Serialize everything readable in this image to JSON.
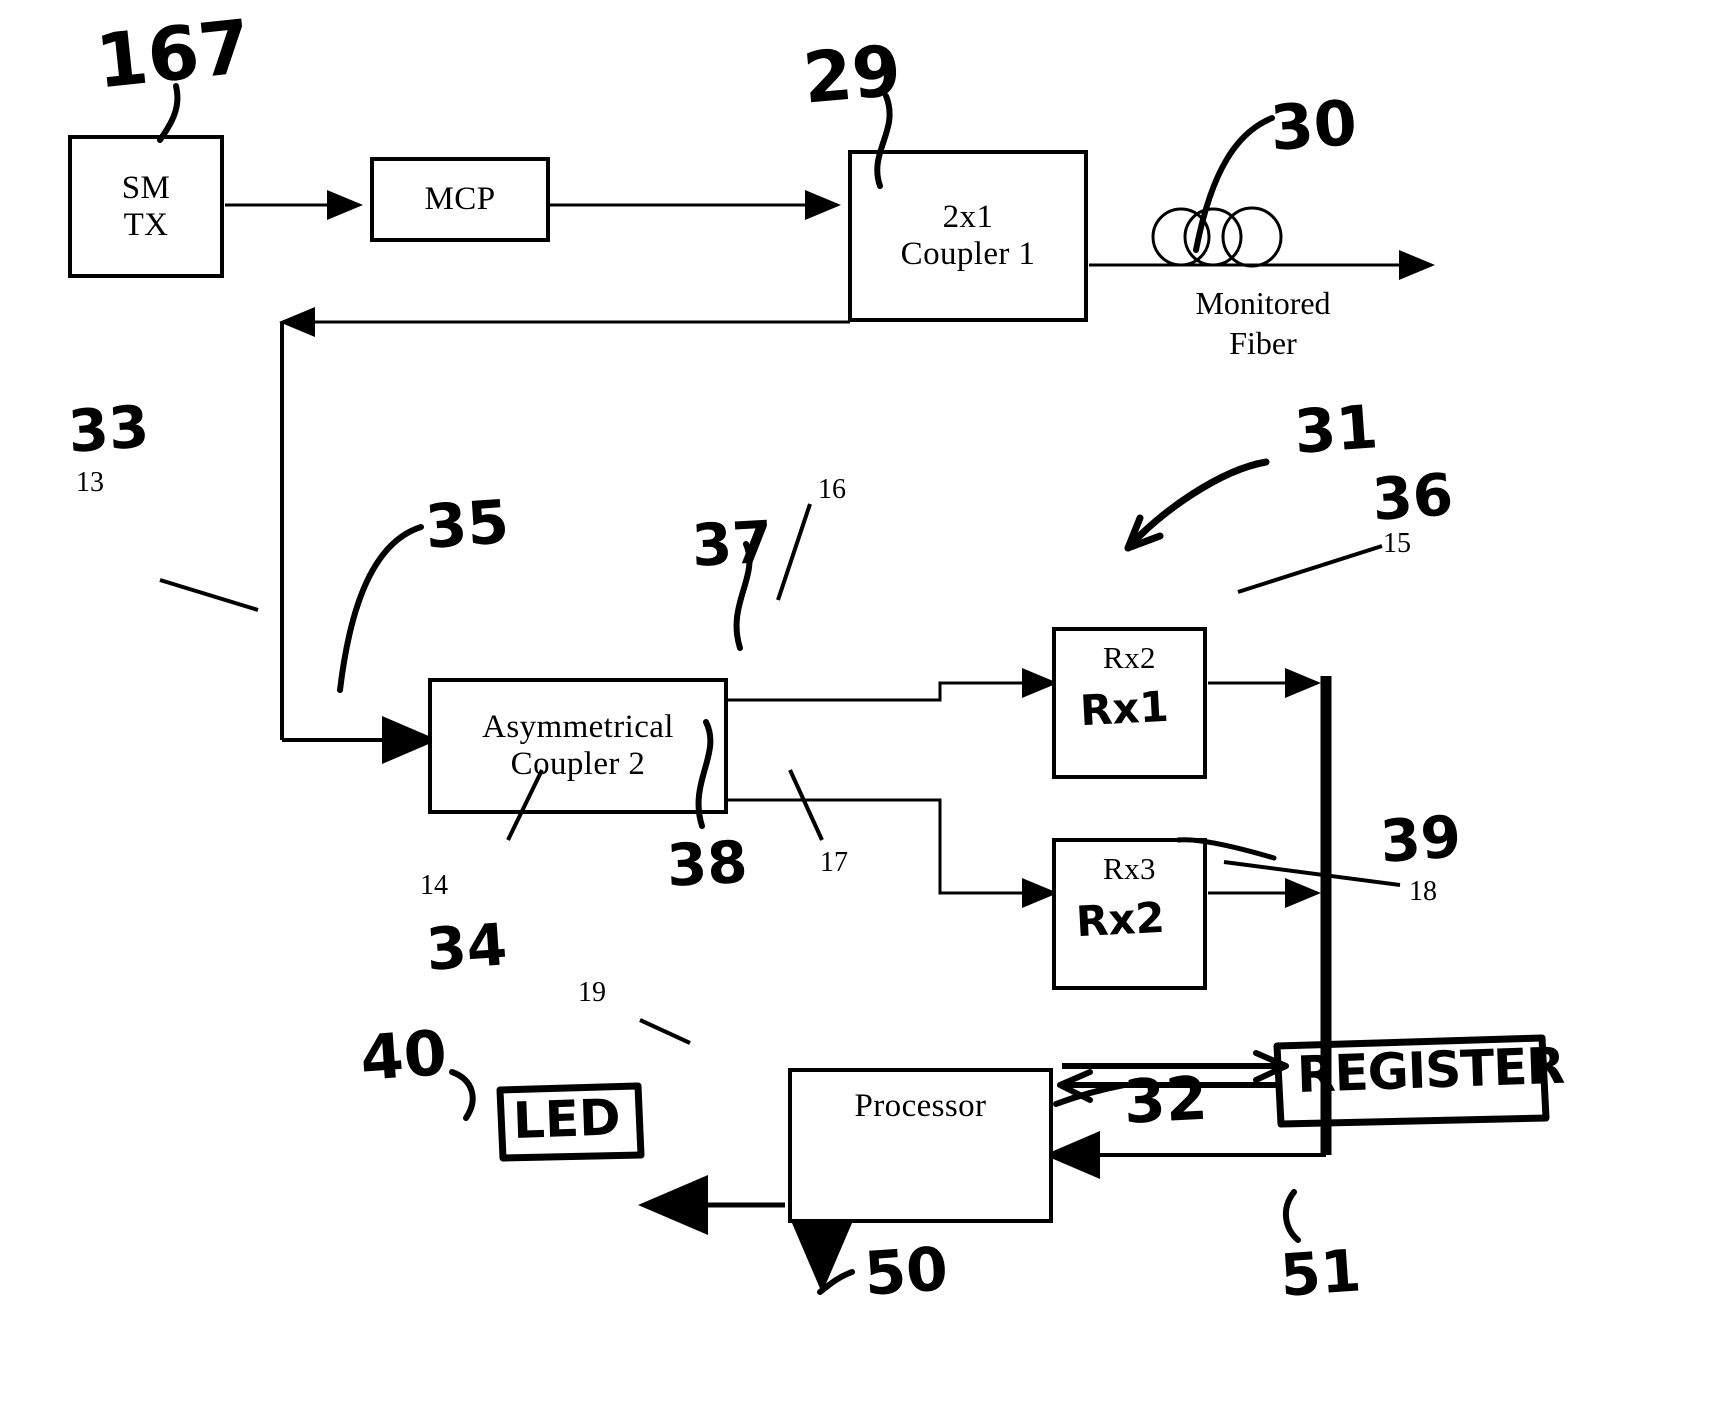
{
  "figure": {
    "kind": "patent-block-diagram",
    "description": "Fiber optic monitoring block diagram with handwritten annotations",
    "ink_color": "#000000",
    "background_color": "#ffffff"
  },
  "blocks": [
    {
      "id": "sm_tx",
      "label_line1": "SM",
      "label_line2": "TX"
    },
    {
      "id": "mcp",
      "label_line1": "MCP",
      "label_line2": ""
    },
    {
      "id": "coupler1",
      "label_line1": "2x1",
      "label_line2": "Coupler 1"
    },
    {
      "id": "coupler2",
      "label_line1": "Asymmetrical",
      "label_line2": "Coupler 2"
    },
    {
      "id": "rx2",
      "label_line1": "Rx2",
      "label_line2": ""
    },
    {
      "id": "rx3",
      "label_line1": "Rx3",
      "label_line2": ""
    },
    {
      "id": "processor",
      "label_line1": "Processor",
      "label_line2": ""
    }
  ],
  "captions": {
    "monitored_fiber_line1": "Monitored",
    "monitored_fiber_line2": "Fiber"
  },
  "handwritten": {
    "sm_tx_ref": "167",
    "coupler1_ref": "29",
    "fiber_ref": "30",
    "return_path_ref": "33",
    "coupler2_ref": "35",
    "coupler2_ref_lower": "34",
    "upper_tap_ref": "37",
    "lower_tap_ref": "38",
    "receivers_group_ref": "31",
    "rx2_box_ref": "36",
    "bus_ref": "39",
    "rx2_inside": "Rx1",
    "rx3_inside": "Rx2",
    "led_ref": "40",
    "led_label": "LED",
    "processor_out_ref": "50",
    "register_feedback_ref": "32",
    "register_label": "REGISTER",
    "register_ref": "51"
  },
  "printed_refs": {
    "return_path": "13",
    "coupler2": "14",
    "rx2_box": "15",
    "upper_tap": "16",
    "lower_tap": "17",
    "bus": "18",
    "processor": "19"
  }
}
